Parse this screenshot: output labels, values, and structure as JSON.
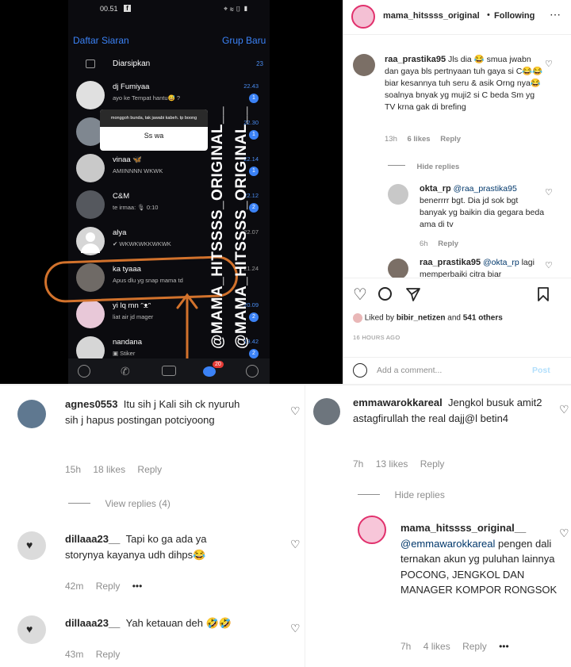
{
  "phone": {
    "status": {
      "time": "00.51",
      "fb_glyph": "f",
      "right_icons": "⌖ ≋ ▯ ▮"
    },
    "topbar": {
      "left": "Daftar Siaran",
      "right": "Grup Baru"
    },
    "archived": {
      "label": "Diarsipkan",
      "count": "23"
    },
    "chats": [
      {
        "name": "dj Fumiyaa",
        "msg": "ayo ke Tempat hantu😅 ?",
        "time": "22.43",
        "badge": "1"
      },
      {
        "name": "",
        "msg": "",
        "time": "22.30",
        "badge": "1"
      },
      {
        "name": "vinaa 🦋",
        "msg": "AMIINNNN WKWK",
        "time": "22.14",
        "badge": "1"
      },
      {
        "name": "C&M",
        "msg": "te irmaa: 🎙 0:10",
        "time": "22.12",
        "badge": "2"
      },
      {
        "name": "alya",
        "msg": "✔ WKWKWKKWKWK",
        "time": "22.07",
        "badge": ""
      },
      {
        "name": "ka tyaaa",
        "msg": "Apus dlu yg snap mama td",
        "time": "21.24",
        "badge": ""
      },
      {
        "name": "yi lq mn ᵔᴥᵔ",
        "msg": "liat air jd mager",
        "time": "20.09",
        "badge": "2"
      },
      {
        "name": "nandana",
        "msg": "▣ Stiker",
        "time": "19.42",
        "badge": "2"
      }
    ],
    "popup": {
      "top": "monggoh bunda, tak jawabi kabeh. tp boong",
      "bottom": "Ss wa"
    },
    "nav_badge": "20",
    "watermark": "@MAMA_HITSSSS_ORIGINAL__"
  },
  "post": {
    "header": {
      "username": "mama_hitssss_original",
      "dot": "•",
      "following": "Following",
      "more": "⋯"
    },
    "comments": [
      {
        "username": "raa_prastika95",
        "text": "Jls dia 😂 smua jwabn dan gaya bls pertnyaan tuh gaya si C😂😂 biar kesannya tuh seru & asik Orng nya😂 soalnya bnyak yg muji2 si C beda Sm yg TV krna gak di brefing",
        "time": "13h",
        "likes": "6 likes",
        "reply": "Reply"
      }
    ],
    "hide_replies": "Hide replies",
    "replies": [
      {
        "username": "okta_rp",
        "mention": "@raa_prastika95",
        "text": "benerrrr bgt. Dia jd sok bgt banyak yg baikin dia gegara beda ama di tv",
        "time": "6h",
        "reply": "Reply"
      },
      {
        "username": "raa_prastika95",
        "mention": "@okta_rp",
        "text": "lagi memperbaiki citra biar"
      }
    ],
    "liked_by": {
      "prefix": "Liked by",
      "user": "bibir_netizen",
      "and": "and",
      "count": "541 others"
    },
    "date": "16 HOURS AGO",
    "add_comment_placeholder": "Add a comment...",
    "post_label": "Post"
  },
  "bottom_left": {
    "comments": [
      {
        "username": "agnes0553",
        "text": "Itu sih j Kali sih ck nyuruh sih j hapus postingan potciyoong",
        "time": "15h",
        "likes": "18 likes",
        "reply": "Reply",
        "view_replies": "View replies (4)"
      },
      {
        "username": "dillaaa23__",
        "text": "Tapi ko ga ada ya storynya kayanya udh dihps😂",
        "time": "42m",
        "reply": "Reply",
        "more": "•••"
      },
      {
        "username": "dillaaa23__",
        "text": "Yah ketauan deh 🤣🤣",
        "time": "43m",
        "reply": "Reply"
      }
    ]
  },
  "bottom_right": {
    "comment": {
      "username": "emmawarokkareal",
      "text": "Jengkol busuk amit2 astagfirullah the real dajj@l betin4",
      "time": "7h",
      "likes": "13 likes",
      "reply": "Reply"
    },
    "hide_replies": "Hide replies",
    "reply": {
      "username": "mama_hitssss_original__",
      "mention": "@emmawarokkareal",
      "text": "pengen dali ternakan akun yg puluhan lainnya POCONG, JENGKOL DAN MANAGER KOMPOR RONGSOK",
      "time": "7h",
      "likes": "4 likes",
      "reply": "Reply",
      "more": "•••"
    }
  }
}
